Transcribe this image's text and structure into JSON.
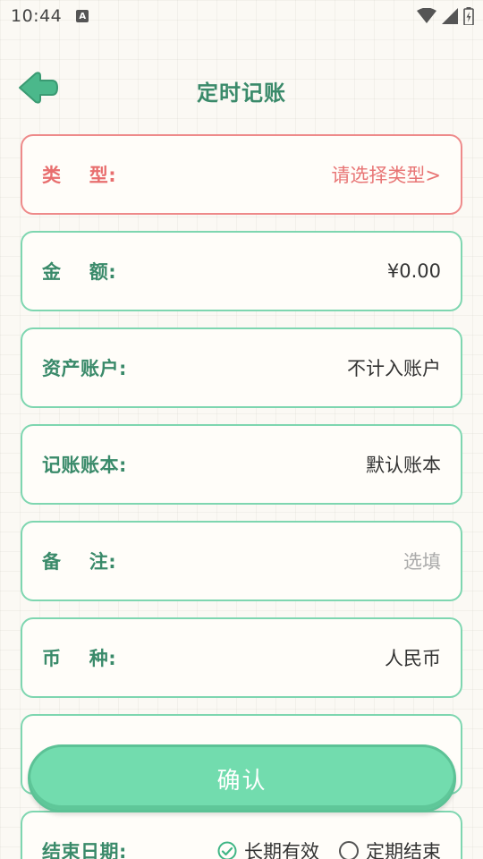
{
  "status_bar": {
    "time": "10:44",
    "notification_icon": "A",
    "icons": [
      "wifi-icon",
      "signal-icon",
      "battery-icon"
    ]
  },
  "header": {
    "title": "定时记账",
    "back_icon": "arrow-left-icon"
  },
  "form": {
    "type": {
      "label": "类    型:",
      "value": "请选择类型>"
    },
    "amount": {
      "label": "金    额:",
      "value": "¥0.00"
    },
    "asset_account": {
      "label": "资产账户:",
      "value": "不计入账户"
    },
    "ledger": {
      "label": "记账账本:",
      "value": "默认账本"
    },
    "note": {
      "label": "备    注:",
      "placeholder": "选填"
    },
    "currency": {
      "label": "币    种:",
      "value": "人民币"
    },
    "end_date": {
      "label": "结束日期:",
      "options": [
        {
          "label": "长期有效",
          "selected": true
        },
        {
          "label": "定期结束",
          "selected": false
        }
      ]
    }
  },
  "confirm_button": {
    "label": "确认"
  },
  "colors": {
    "accent": "#3a8a6a",
    "border": "#7ed6b0",
    "error": "#ee8a8a",
    "button": "#72dcae"
  }
}
